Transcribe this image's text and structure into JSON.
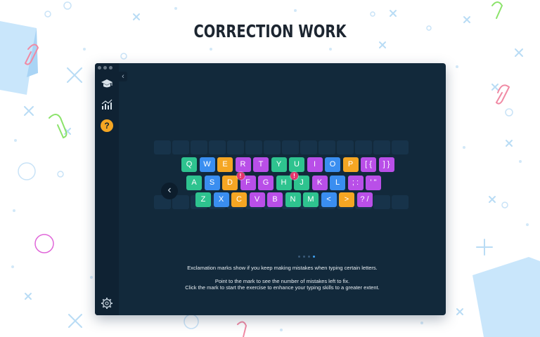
{
  "headline": "CORRECTION WORK",
  "window": {
    "sidebar": {
      "items": [
        {
          "icon": "graduation-cap-icon"
        },
        {
          "icon": "statistics-chart-icon"
        },
        {
          "icon": "help-icon",
          "glyph": "?",
          "color": "#f5a623"
        }
      ],
      "settings_icon": "gear-icon",
      "collapse_glyph": "‹"
    },
    "keyboard": {
      "rows": [
        [
          {
            "label": "Q",
            "color": "#2ec38f"
          },
          {
            "label": "W",
            "color": "#3a8ef0"
          },
          {
            "label": "E",
            "color": "#f5a623"
          },
          {
            "label": "R",
            "color": "#b94fe8"
          },
          {
            "label": "T",
            "color": "#b94fe8"
          },
          {
            "label": "Y",
            "color": "#2ec38f"
          },
          {
            "label": "U",
            "color": "#2ec38f"
          },
          {
            "label": "I",
            "color": "#b94fe8"
          },
          {
            "label": "O",
            "color": "#3a8ef0"
          },
          {
            "label": "P",
            "color": "#f5a623"
          },
          {
            "label": "[ {",
            "color": "#b94fe8"
          },
          {
            "label": "] }",
            "color": "#b94fe8"
          }
        ],
        [
          {
            "label": "A",
            "color": "#2ec38f"
          },
          {
            "label": "S",
            "color": "#3a8ef0"
          },
          {
            "label": "D",
            "color": "#f5a623"
          },
          {
            "label": "F",
            "color": "#b94fe8",
            "mistake": true
          },
          {
            "label": "G",
            "color": "#b94fe8"
          },
          {
            "label": "H",
            "color": "#2ec38f"
          },
          {
            "label": "J",
            "color": "#2ec38f",
            "mistake": true
          },
          {
            "label": "K",
            "color": "#b94fe8"
          },
          {
            "label": "L",
            "color": "#3a8ef0"
          },
          {
            "label": "; :",
            "color": "#b94fe8"
          },
          {
            "label": "' \"",
            "color": "#b94fe8"
          }
        ],
        [
          {
            "label": "Z",
            "color": "#2ec38f"
          },
          {
            "label": "X",
            "color": "#3a8ef0"
          },
          {
            "label": "C",
            "color": "#f5a623"
          },
          {
            "label": "V",
            "color": "#b94fe8"
          },
          {
            "label": "B",
            "color": "#b94fe8"
          },
          {
            "label": "N",
            "color": "#2ec38f"
          },
          {
            "label": "M",
            "color": "#2ec38f"
          },
          {
            "label": "<",
            "color": "#3a8ef0"
          },
          {
            "label": ">",
            "color": "#f5a623"
          },
          {
            "label": "? /",
            "color": "#b94fe8"
          }
        ]
      ],
      "mistake_glyph": "!"
    },
    "nav_back_glyph": "‹",
    "pagination": {
      "total": 4,
      "active_index": 3
    },
    "message": {
      "line1": "Exclamation marks show if you keep making mistakes when typing certain letters.",
      "line2": "Point to the mark to see the number of mistakes left to fix.",
      "line3": "Click the mark to start the exercise to enhance your typing skills to a greater extent."
    }
  }
}
